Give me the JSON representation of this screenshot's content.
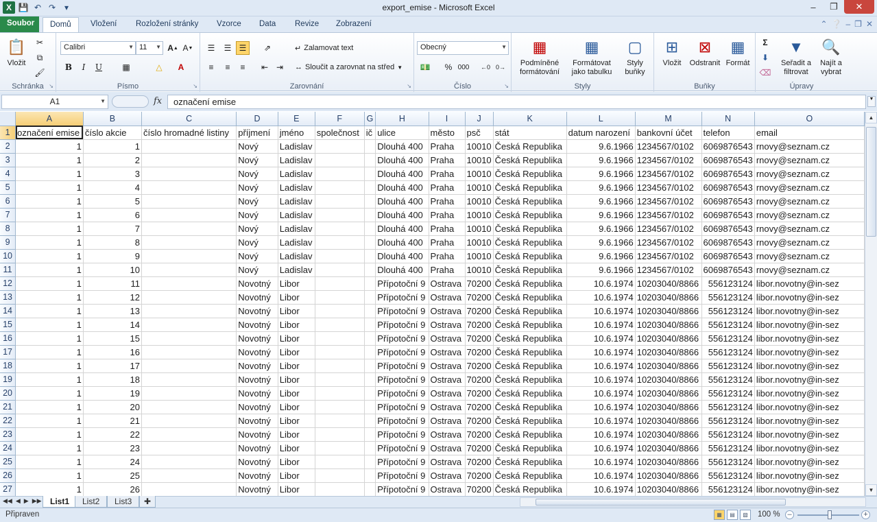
{
  "window": {
    "title": "export_emise  -  Microsoft Excel",
    "logo": "X"
  },
  "tabs": [
    "Soubor",
    "Domů",
    "Vložení",
    "Rozložení stránky",
    "Vzorce",
    "Data",
    "Revize",
    "Zobrazení"
  ],
  "ribbon": {
    "clipboard": {
      "label": "Schránka",
      "paste": "Vložit"
    },
    "font": {
      "label": "Písmo",
      "name": "Calibri",
      "size": "11",
      "bold": "B",
      "italic": "I",
      "underline": "U"
    },
    "alignment": {
      "label": "Zarovnání",
      "wrap": "Zalamovat text",
      "merge": "Sloučit a zarovnat na střed"
    },
    "number": {
      "label": "Číslo",
      "format": "Obecný",
      "percent": "%",
      "thousands": "000"
    },
    "styles": {
      "label": "Styly",
      "conditional": [
        "Podmíněné",
        "formátování"
      ],
      "as_table": [
        "Formátovat",
        "jako tabulku"
      ],
      "cell_styles": [
        "Styly",
        "buňky"
      ]
    },
    "cells": {
      "label": "Buňky",
      "insert": "Vložit",
      "delete": "Odstranit",
      "format": "Formát"
    },
    "editing": {
      "label": "Úpravy",
      "sort": [
        "Seřadit a",
        "filtrovat"
      ],
      "find": [
        "Najít a",
        "vybrat"
      ]
    }
  },
  "formula_bar": {
    "name_box": "A1",
    "fx": "fx",
    "content": "označení emise"
  },
  "columns": [
    "A",
    "B",
    "C",
    "D",
    "E",
    "F",
    "G",
    "H",
    "I",
    "J",
    "K",
    "L",
    "M",
    "N",
    "O"
  ],
  "header_row": [
    "označení emise",
    "číslo akcie",
    "číslo hromadné listiny",
    "příjmení",
    "jméno",
    "společnost",
    "ič",
    "ulice",
    "město",
    "psč",
    "stát",
    "datum narození",
    "bankovní účet",
    "telefon",
    "email"
  ],
  "rows": [
    [
      "1",
      "1",
      "",
      "Nový",
      "Ladislav",
      "",
      "",
      "Dlouhá 400",
      "Praha",
      "10010",
      "Česká Republika",
      "9.6.1966",
      "1234567/0102",
      "6069876543",
      "rnovy@seznam.cz"
    ],
    [
      "1",
      "2",
      "",
      "Nový",
      "Ladislav",
      "",
      "",
      "Dlouhá 400",
      "Praha",
      "10010",
      "Česká Republika",
      "9.6.1966",
      "1234567/0102",
      "6069876543",
      "rnovy@seznam.cz"
    ],
    [
      "1",
      "3",
      "",
      "Nový",
      "Ladislav",
      "",
      "",
      "Dlouhá 400",
      "Praha",
      "10010",
      "Česká Republika",
      "9.6.1966",
      "1234567/0102",
      "6069876543",
      "rnovy@seznam.cz"
    ],
    [
      "1",
      "4",
      "",
      "Nový",
      "Ladislav",
      "",
      "",
      "Dlouhá 400",
      "Praha",
      "10010",
      "Česká Republika",
      "9.6.1966",
      "1234567/0102",
      "6069876543",
      "rnovy@seznam.cz"
    ],
    [
      "1",
      "5",
      "",
      "Nový",
      "Ladislav",
      "",
      "",
      "Dlouhá 400",
      "Praha",
      "10010",
      "Česká Republika",
      "9.6.1966",
      "1234567/0102",
      "6069876543",
      "rnovy@seznam.cz"
    ],
    [
      "1",
      "6",
      "",
      "Nový",
      "Ladislav",
      "",
      "",
      "Dlouhá 400",
      "Praha",
      "10010",
      "Česká Republika",
      "9.6.1966",
      "1234567/0102",
      "6069876543",
      "rnovy@seznam.cz"
    ],
    [
      "1",
      "7",
      "",
      "Nový",
      "Ladislav",
      "",
      "",
      "Dlouhá 400",
      "Praha",
      "10010",
      "Česká Republika",
      "9.6.1966",
      "1234567/0102",
      "6069876543",
      "rnovy@seznam.cz"
    ],
    [
      "1",
      "8",
      "",
      "Nový",
      "Ladislav",
      "",
      "",
      "Dlouhá 400",
      "Praha",
      "10010",
      "Česká Republika",
      "9.6.1966",
      "1234567/0102",
      "6069876543",
      "rnovy@seznam.cz"
    ],
    [
      "1",
      "9",
      "",
      "Nový",
      "Ladislav",
      "",
      "",
      "Dlouhá 400",
      "Praha",
      "10010",
      "Česká Republika",
      "9.6.1966",
      "1234567/0102",
      "6069876543",
      "rnovy@seznam.cz"
    ],
    [
      "1",
      "10",
      "",
      "Nový",
      "Ladislav",
      "",
      "",
      "Dlouhá 400",
      "Praha",
      "10010",
      "Česká Republika",
      "9.6.1966",
      "1234567/0102",
      "6069876543",
      "rnovy@seznam.cz"
    ],
    [
      "1",
      "11",
      "",
      "Novotný",
      "Libor",
      "",
      "",
      "Přípotoční 9",
      "Ostrava",
      "70200",
      "Česká Republika",
      "10.6.1974",
      "10203040/8866",
      "556123124",
      "libor.novotny@in-sez"
    ],
    [
      "1",
      "12",
      "",
      "Novotný",
      "Libor",
      "",
      "",
      "Přípotoční 9",
      "Ostrava",
      "70200",
      "Česká Republika",
      "10.6.1974",
      "10203040/8866",
      "556123124",
      "libor.novotny@in-sez"
    ],
    [
      "1",
      "13",
      "",
      "Novotný",
      "Libor",
      "",
      "",
      "Přípotoční 9",
      "Ostrava",
      "70200",
      "Česká Republika",
      "10.6.1974",
      "10203040/8866",
      "556123124",
      "libor.novotny@in-sez"
    ],
    [
      "1",
      "14",
      "",
      "Novotný",
      "Libor",
      "",
      "",
      "Přípotoční 9",
      "Ostrava",
      "70200",
      "Česká Republika",
      "10.6.1974",
      "10203040/8866",
      "556123124",
      "libor.novotny@in-sez"
    ],
    [
      "1",
      "15",
      "",
      "Novotný",
      "Libor",
      "",
      "",
      "Přípotoční 9",
      "Ostrava",
      "70200",
      "Česká Republika",
      "10.6.1974",
      "10203040/8866",
      "556123124",
      "libor.novotny@in-sez"
    ],
    [
      "1",
      "16",
      "",
      "Novotný",
      "Libor",
      "",
      "",
      "Přípotoční 9",
      "Ostrava",
      "70200",
      "Česká Republika",
      "10.6.1974",
      "10203040/8866",
      "556123124",
      "libor.novotny@in-sez"
    ],
    [
      "1",
      "17",
      "",
      "Novotný",
      "Libor",
      "",
      "",
      "Přípotoční 9",
      "Ostrava",
      "70200",
      "Česká Republika",
      "10.6.1974",
      "10203040/8866",
      "556123124",
      "libor.novotny@in-sez"
    ],
    [
      "1",
      "18",
      "",
      "Novotný",
      "Libor",
      "",
      "",
      "Přípotoční 9",
      "Ostrava",
      "70200",
      "Česká Republika",
      "10.6.1974",
      "10203040/8866",
      "556123124",
      "libor.novotny@in-sez"
    ],
    [
      "1",
      "19",
      "",
      "Novotný",
      "Libor",
      "",
      "",
      "Přípotoční 9",
      "Ostrava",
      "70200",
      "Česká Republika",
      "10.6.1974",
      "10203040/8866",
      "556123124",
      "libor.novotny@in-sez"
    ],
    [
      "1",
      "20",
      "",
      "Novotný",
      "Libor",
      "",
      "",
      "Přípotoční 9",
      "Ostrava",
      "70200",
      "Česká Republika",
      "10.6.1974",
      "10203040/8866",
      "556123124",
      "libor.novotny@in-sez"
    ],
    [
      "1",
      "21",
      "",
      "Novotný",
      "Libor",
      "",
      "",
      "Přípotoční 9",
      "Ostrava",
      "70200",
      "Česká Republika",
      "10.6.1974",
      "10203040/8866",
      "556123124",
      "libor.novotny@in-sez"
    ],
    [
      "1",
      "22",
      "",
      "Novotný",
      "Libor",
      "",
      "",
      "Přípotoční 9",
      "Ostrava",
      "70200",
      "Česká Republika",
      "10.6.1974",
      "10203040/8866",
      "556123124",
      "libor.novotny@in-sez"
    ],
    [
      "1",
      "23",
      "",
      "Novotný",
      "Libor",
      "",
      "",
      "Přípotoční 9",
      "Ostrava",
      "70200",
      "Česká Republika",
      "10.6.1974",
      "10203040/8866",
      "556123124",
      "libor.novotny@in-sez"
    ],
    [
      "1",
      "24",
      "",
      "Novotný",
      "Libor",
      "",
      "",
      "Přípotoční 9",
      "Ostrava",
      "70200",
      "Česká Republika",
      "10.6.1974",
      "10203040/8866",
      "556123124",
      "libor.novotny@in-sez"
    ],
    [
      "1",
      "25",
      "",
      "Novotný",
      "Libor",
      "",
      "",
      "Přípotoční 9",
      "Ostrava",
      "70200",
      "Česká Republika",
      "10.6.1974",
      "10203040/8866",
      "556123124",
      "libor.novotny@in-sez"
    ],
    [
      "1",
      "26",
      "",
      "Novotný",
      "Libor",
      "",
      "",
      "Přípotoční 9",
      "Ostrava",
      "70200",
      "Česká Republika",
      "10.6.1974",
      "10203040/8866",
      "556123124",
      "libor.novotny@in-sez"
    ]
  ],
  "sheets": [
    "List1",
    "List2",
    "List3"
  ],
  "status": {
    "ready": "Připraven",
    "zoom": "100 %"
  },
  "colors": {
    "file_tab": "#2a8a4a",
    "selection_header": "#f6ce76",
    "ribbon_bg": "#dfe9f5"
  }
}
